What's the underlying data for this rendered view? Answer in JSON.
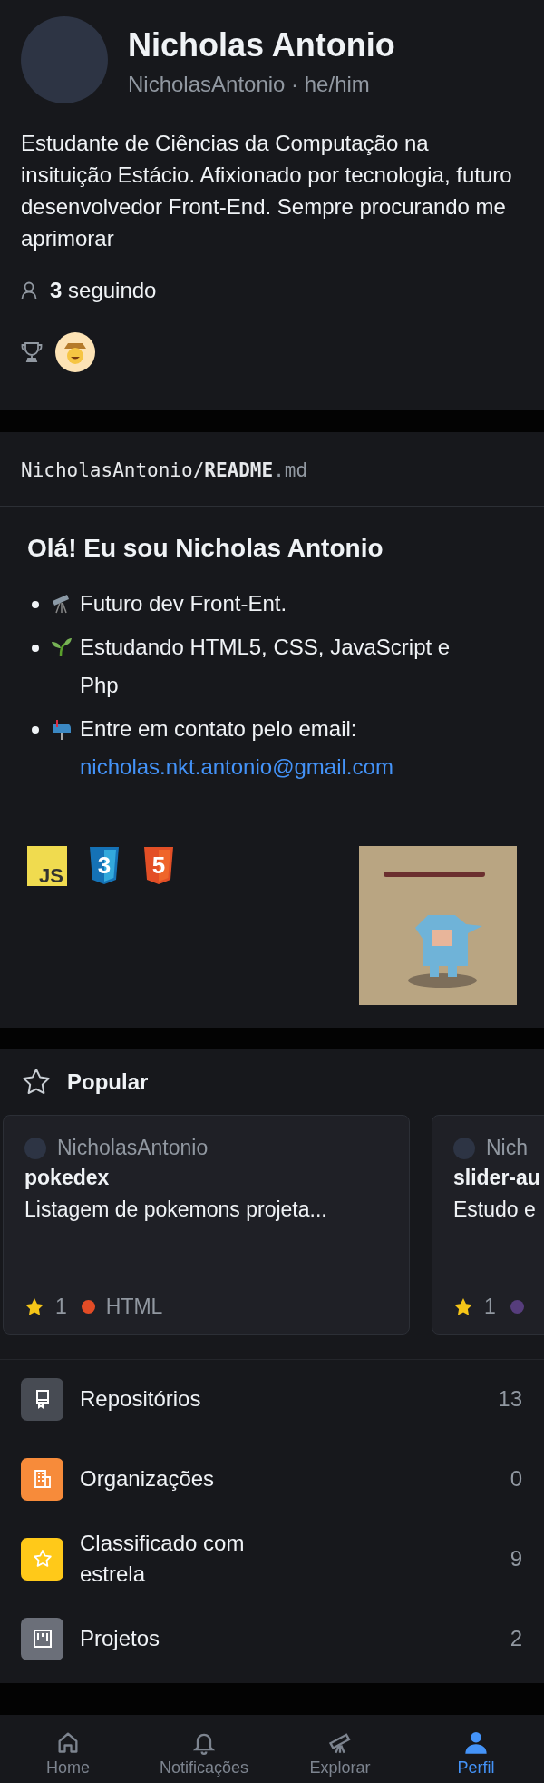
{
  "profile": {
    "name": "Nicholas Antonio",
    "handle": "NicholasAntonio · he/him",
    "bio": "Estudante de Ciências da Computação na insituição Estácio. Afixionado por tecnologia, futuro desenvolvedor Front-End. Sempre procurando me aprimorar",
    "following": "**3** seguindo"
  },
  "readme": {
    "owner": "NicholasAntonio/",
    "file": "README",
    "ext": ".md",
    "heading": "Olá! Eu sou Nicholas Antonio",
    "bullets": [
      {
        "kind": "telescope",
        "text": "Futuro dev Front-Ent."
      },
      {
        "kind": "seedling",
        "text": "Estudando HTML5, CSS, JavaScript e Php"
      },
      {
        "kind": "mailbox",
        "text": "Entre em contato pelo email:",
        "link": "nicholas.nkt.antonio@gmail.com"
      }
    ],
    "tech_icons": [
      {
        "kind": "js",
        "label": "JS"
      },
      {
        "kind": "css3",
        "label": "3"
      },
      {
        "kind": "html5",
        "label": "5"
      }
    ]
  },
  "popular": {
    "title": "Popular",
    "cards": [
      {
        "owner": "NicholasAntonio",
        "name": "pokedex",
        "description": "Listagem de pokemons projeta...",
        "stars": "1",
        "language": "HTML",
        "color": "#e34c26"
      },
      {
        "owner": "Nich",
        "name": "slider-au",
        "description": "Estudo e",
        "stars": "1",
        "color": "#563d7c"
      }
    ]
  },
  "menu": [
    {
      "kind": "repo",
      "label": "Repositórios",
      "count": "13",
      "color": "#474b53"
    },
    {
      "kind": "org",
      "label": "Organizações",
      "count": "0",
      "color": "#f78b3a"
    },
    {
      "kind": "star",
      "label": "Classificado com estrela",
      "count": "9",
      "color": "#ffc919"
    },
    {
      "kind": "project",
      "label": "Projetos",
      "count": "2",
      "color": "#6b6f79"
    }
  ],
  "tabs": [
    {
      "kind": "home",
      "label": "Home",
      "selected": false
    },
    {
      "kind": "bell",
      "label": "Notificações",
      "selected": false
    },
    {
      "kind": "telescope",
      "label": "Explorar",
      "selected": false
    },
    {
      "kind": "person",
      "label": "Perfil",
      "selected": true
    }
  ]
}
